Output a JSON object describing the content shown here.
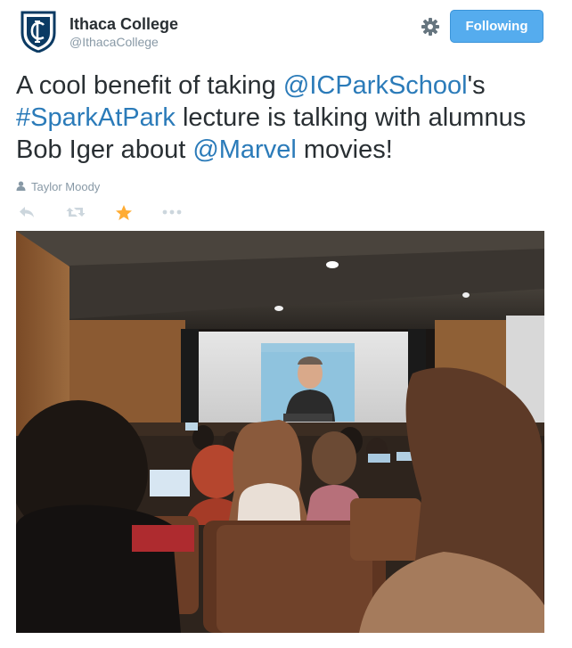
{
  "account": {
    "display_name": "Ithaca College",
    "screen_name": "@IthacaCollege"
  },
  "follow_button": {
    "label": "Following"
  },
  "tweet": {
    "segments": [
      {
        "text": "A cool benefit of taking ",
        "link": false
      },
      {
        "text": "@ICParkSchool",
        "link": true
      },
      {
        "text": "'s ",
        "link": false
      },
      {
        "text": "#SparkAtPark",
        "link": true
      },
      {
        "text": " lecture is talking with alumnus Bob Iger about ",
        "link": false
      },
      {
        "text": "@Marvel",
        "link": true
      },
      {
        "text": " movies!",
        "link": false
      }
    ]
  },
  "photo_credit": {
    "name": "Taylor Moody"
  },
  "actions": {
    "favorited": true,
    "icons": [
      "reply-icon",
      "retweet-icon",
      "favorite-icon",
      "more-icon"
    ]
  },
  "colors": {
    "link": "#2b7bb9",
    "follow_button": "#55acee",
    "favorite_active": "#ffac33",
    "muted": "#8899a6"
  }
}
